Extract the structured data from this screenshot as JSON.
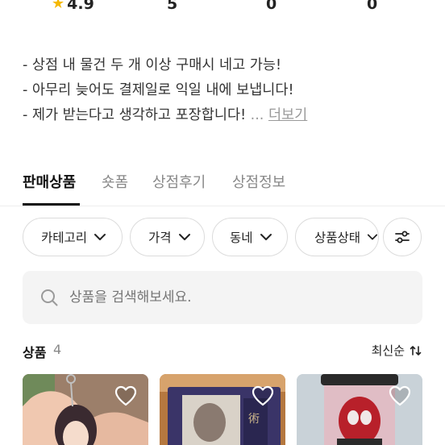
{
  "stats": [
    {
      "value": "4.9",
      "icon": "star-icon"
    },
    {
      "value": "5"
    },
    {
      "value": "0"
    },
    {
      "value": "0"
    }
  ],
  "description": {
    "lines": [
      "- 상점 내 물건 두 개 이상 구매시 네고 가능!",
      "- 아무리 늦어도 결제일로 익일 내에 보냅니다!",
      "- 제가 받는다고 생각하고 포장합니다!"
    ],
    "ellipsis": "...",
    "more_label": "더보기"
  },
  "tabs": [
    {
      "label": "판매상품",
      "active": true
    },
    {
      "label": "숏폼",
      "active": false
    },
    {
      "label": "상점후기",
      "active": false
    },
    {
      "label": "상점정보",
      "active": false
    }
  ],
  "filters": [
    {
      "label": "카테고리"
    },
    {
      "label": "가격"
    },
    {
      "label": "동네"
    },
    {
      "label": "상품상태"
    }
  ],
  "search": {
    "placeholder": "상품을 검색해보세요."
  },
  "products": {
    "title": "상품",
    "count": "4",
    "sort_label": "최신순",
    "items": [
      {
        "image": "keychain-photo",
        "favorite_icon": "heart-outline-icon"
      },
      {
        "image": "card-photo",
        "favorite_icon": "heart-outline-icon"
      },
      {
        "image": "figure-cup-photo",
        "favorite_icon": "heart-outline-icon"
      }
    ]
  },
  "colors": {
    "star": "#f5b800",
    "accent_text": "#111111",
    "muted": "#888888"
  }
}
